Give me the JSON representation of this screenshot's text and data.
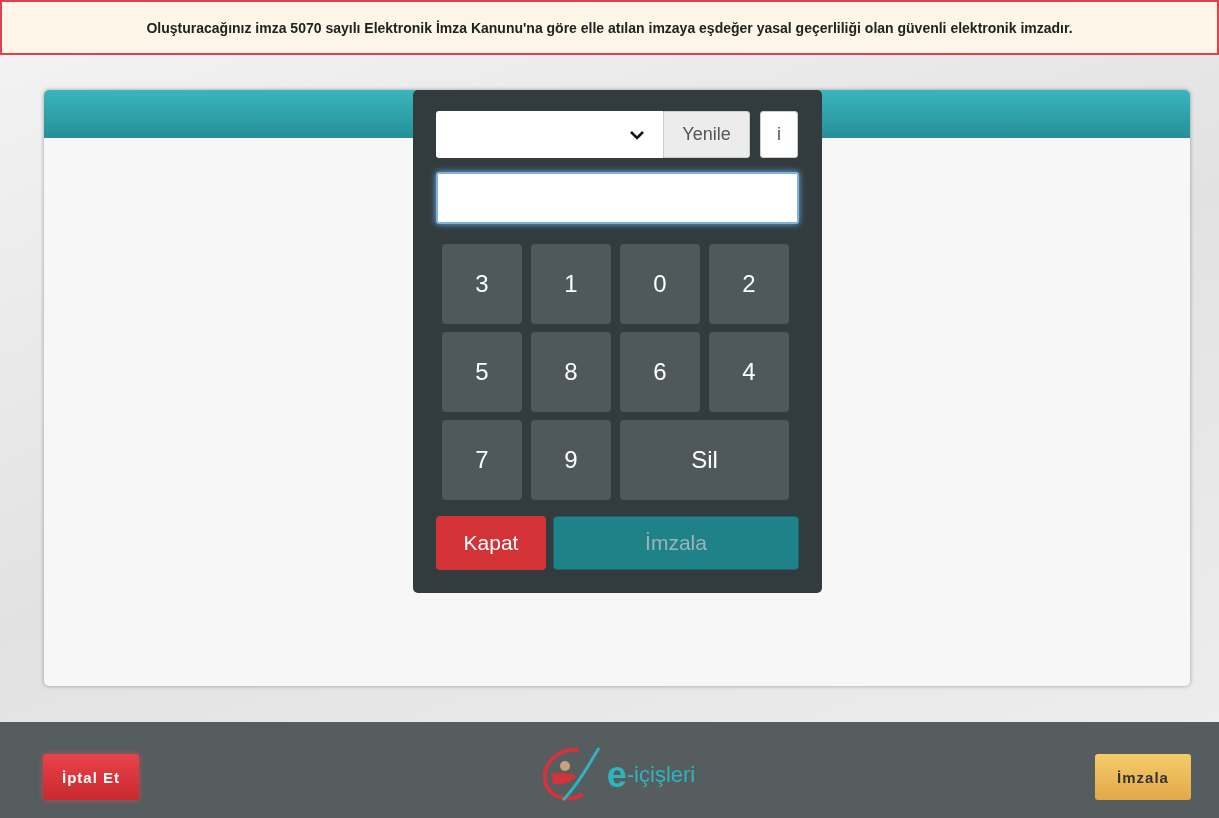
{
  "notice": {
    "text": "Oluşturacağınız imza 5070 sayılı Elektronik İmza Kanunu'na göre elle atılan imzaya eşdeğer yasal geçerliliği olan güvenli elektronik imzadır."
  },
  "keypad": {
    "refresh_button": "Yenile",
    "info_button": "i",
    "keys": [
      {
        "label": "3",
        "kind": "digit"
      },
      {
        "label": "1",
        "kind": "digit"
      },
      {
        "label": "0",
        "kind": "digit"
      },
      {
        "label": "2",
        "kind": "digit"
      },
      {
        "label": "5",
        "kind": "digit"
      },
      {
        "label": "8",
        "kind": "digit"
      },
      {
        "label": "6",
        "kind": "digit"
      },
      {
        "label": "4",
        "kind": "digit"
      },
      {
        "label": "7",
        "kind": "digit"
      },
      {
        "label": "9",
        "kind": "digit"
      },
      {
        "label": "Sil",
        "kind": "delete"
      }
    ],
    "close_button": "Kapat",
    "sign_button": {
      "label": "İmzala",
      "disabled": true
    }
  },
  "footer": {
    "cancel_button": "İptal Et",
    "logo": {
      "mark": "e",
      "text": "-içişleri"
    },
    "sign_button": "İmzala"
  }
}
